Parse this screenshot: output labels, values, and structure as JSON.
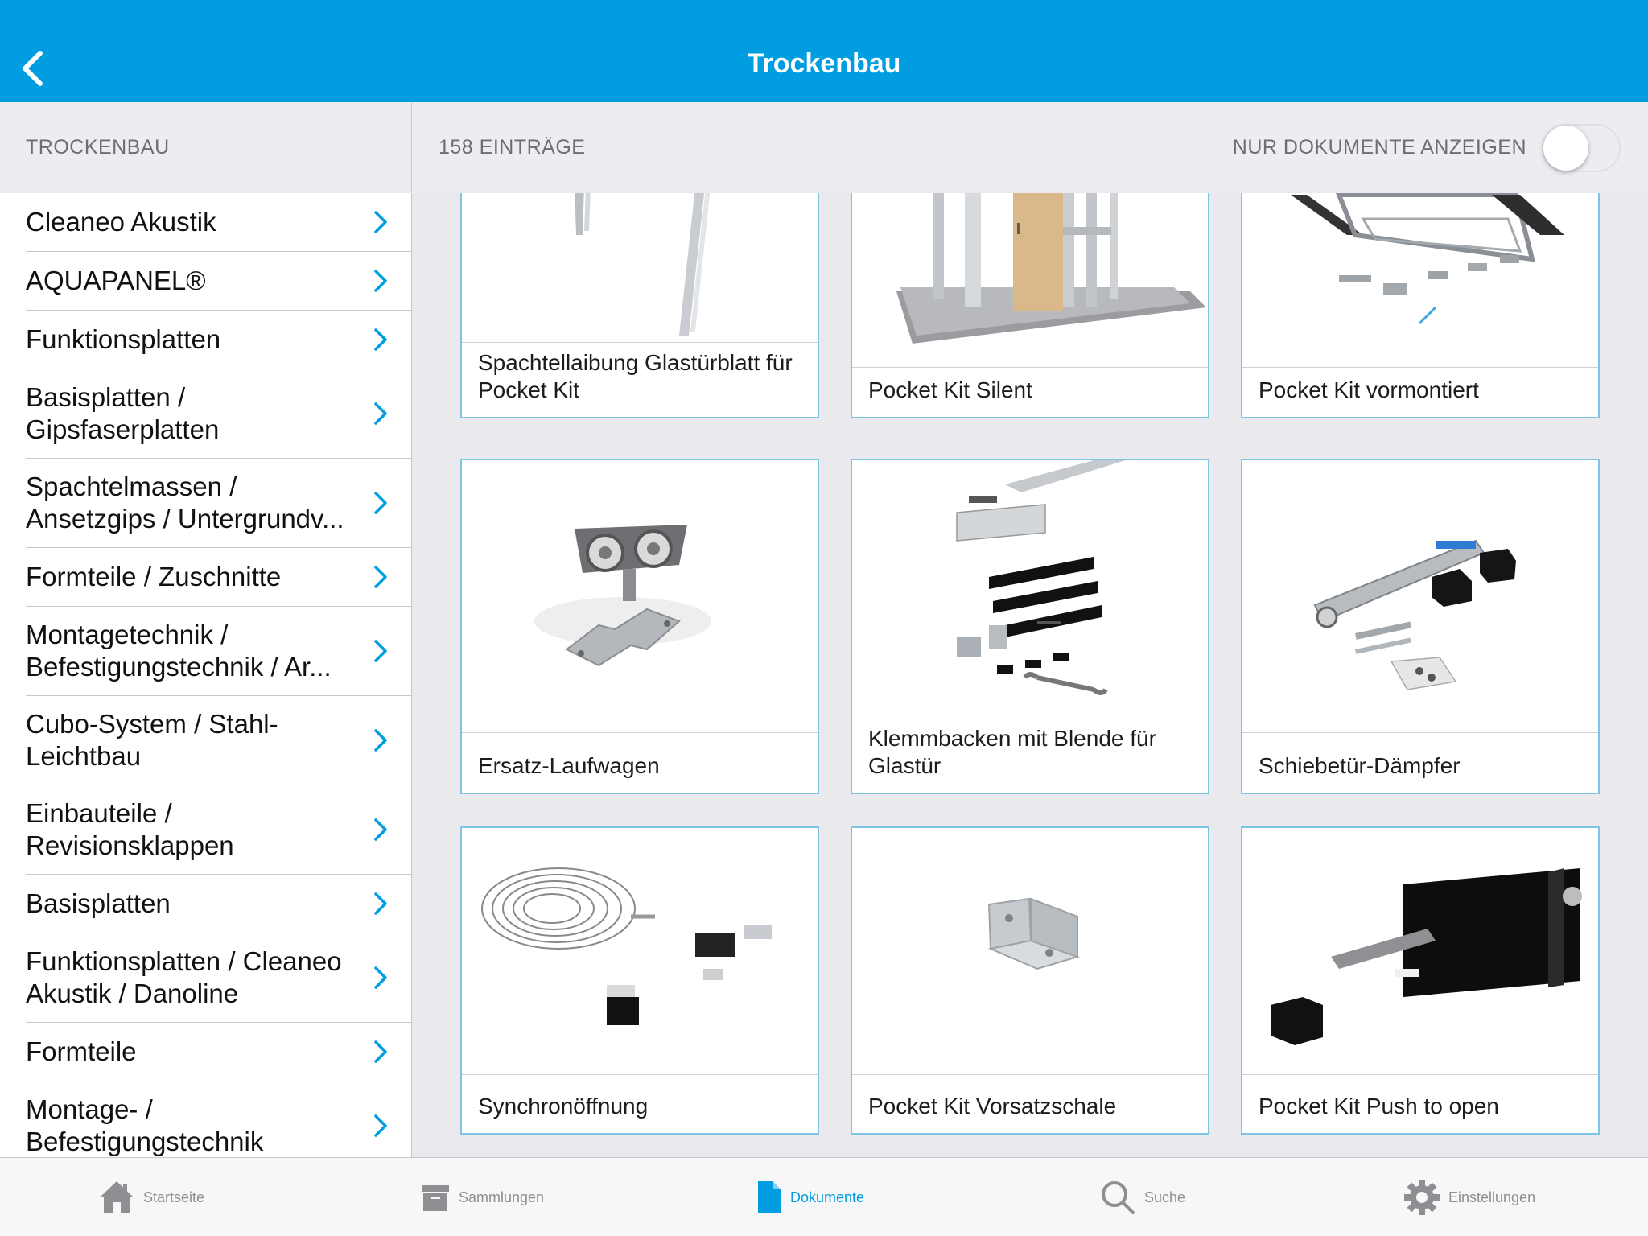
{
  "nav": {
    "title": "Trockenbau"
  },
  "subheader": {
    "section_label": "TROCKENBAU",
    "count": "158 EINTRÄGE",
    "toggle_label": "NUR DOKUMENTE ANZEIGEN",
    "toggle_on": false
  },
  "sidebar": {
    "items": [
      {
        "label": "Cleaneo Akustik"
      },
      {
        "label": "AQUAPANEL®"
      },
      {
        "label": "Funktionsplatten"
      },
      {
        "label": "Basisplatten / Gipsfaserplatten"
      },
      {
        "label": "Spachtelmassen / Ansetzgips / Untergrundv..."
      },
      {
        "label": "Formteile / Zuschnitte"
      },
      {
        "label": "Montagetechnik / Befestigungstechnik / Ar..."
      },
      {
        "label": "Cubo-System / Stahl-Leichtbau"
      },
      {
        "label": "Einbauteile / Revisionsklappen"
      },
      {
        "label": "Basisplatten"
      },
      {
        "label": "Funktionsplatten / Cleaneo Akustik / Danoline"
      },
      {
        "label": "Formteile"
      },
      {
        "label": "Montage- / Befestigungstechnik"
      }
    ]
  },
  "grid": {
    "items": [
      {
        "label": "Spachtellaibung Glastürblatt für Pocket Kit"
      },
      {
        "label": "Pocket Kit Silent"
      },
      {
        "label": "Pocket Kit vormontiert"
      },
      {
        "label": "Ersatz-Laufwagen"
      },
      {
        "label": "Klemmbacken mit Blende für Glastür"
      },
      {
        "label": "Schiebetür-Dämpfer"
      },
      {
        "label": "Synchronöffnung"
      },
      {
        "label": "Pocket Kit Vorsatzschale"
      },
      {
        "label": "Pocket Kit Push to open"
      }
    ]
  },
  "tabbar": {
    "tabs": [
      {
        "label": "Startseite",
        "icon": "home-icon"
      },
      {
        "label": "Sammlungen",
        "icon": "archive-box-icon"
      },
      {
        "label": "Dokumente",
        "icon": "document-icon",
        "active": true
      },
      {
        "label": "Suche",
        "icon": "search-icon"
      },
      {
        "label": "Einstellungen",
        "icon": "gear-icon"
      }
    ]
  },
  "colors": {
    "accent": "#009ee0",
    "card_border": "#7ec4e6",
    "background": "#e9e9ee"
  }
}
